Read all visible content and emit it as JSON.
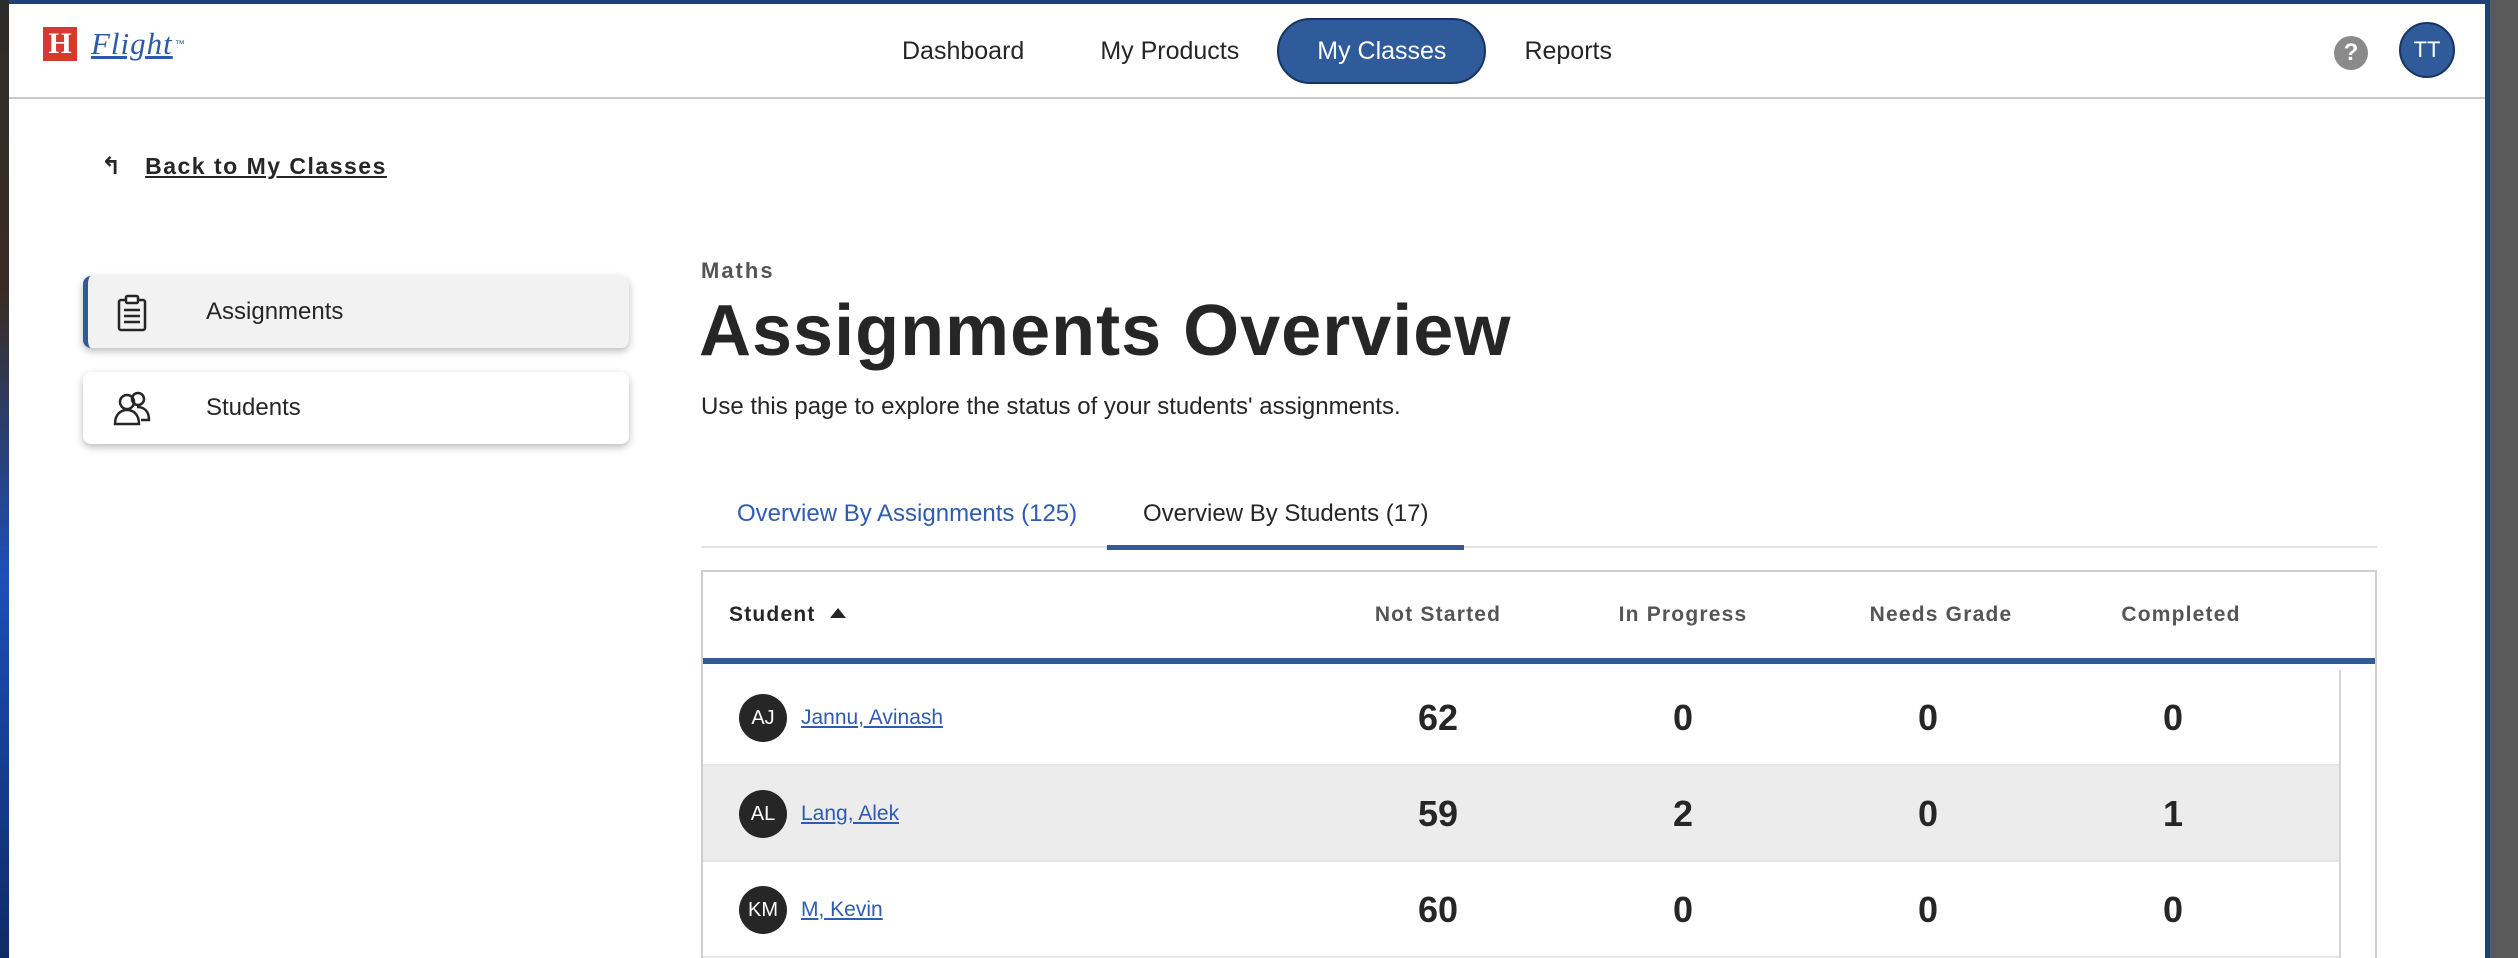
{
  "header": {
    "logo_letter": "H",
    "logo_text": "Flight",
    "logo_tm": "™",
    "nav": [
      {
        "label": "Dashboard",
        "active": false
      },
      {
        "label": "My Products",
        "active": false
      },
      {
        "label": "My Classes",
        "active": true
      },
      {
        "label": "Reports",
        "active": false
      }
    ],
    "help_icon": "?",
    "user_initials": "TT"
  },
  "back_link": {
    "icon": "↰",
    "label": "Back to My Classes"
  },
  "sidebar": {
    "items": [
      {
        "label": "Assignments",
        "icon": "clipboard-icon",
        "active": true
      },
      {
        "label": "Students",
        "icon": "students-icon",
        "active": false
      }
    ]
  },
  "main": {
    "subject": "Maths",
    "title": "Assignments Overview",
    "description": "Use this page to explore the status of your students' assignments.",
    "tabs": [
      {
        "label": "Overview By Assignments (125)",
        "active": false
      },
      {
        "label": "Overview By Students (17)",
        "active": true
      }
    ],
    "table": {
      "columns": {
        "student": "Student",
        "not_started": "Not Started",
        "in_progress": "In Progress",
        "needs_grade": "Needs Grade",
        "completed": "Completed"
      },
      "sort": "ascending",
      "rows": [
        {
          "initials": "AJ",
          "name": "Jannu, Avinash",
          "not_started": "62",
          "in_progress": "0",
          "needs_grade": "0",
          "completed": "0"
        },
        {
          "initials": "AL",
          "name": "Lang, Alek",
          "not_started": "59",
          "in_progress": "2",
          "needs_grade": "0",
          "completed": "1"
        },
        {
          "initials": "KM",
          "name": "M, Kevin",
          "not_started": "60",
          "in_progress": "0",
          "needs_grade": "0",
          "completed": "0"
        }
      ]
    }
  },
  "colors": {
    "primary": "#2f5b9a",
    "link": "#2f5bb0",
    "logo_red": "#d63a2f",
    "text": "#262626"
  }
}
